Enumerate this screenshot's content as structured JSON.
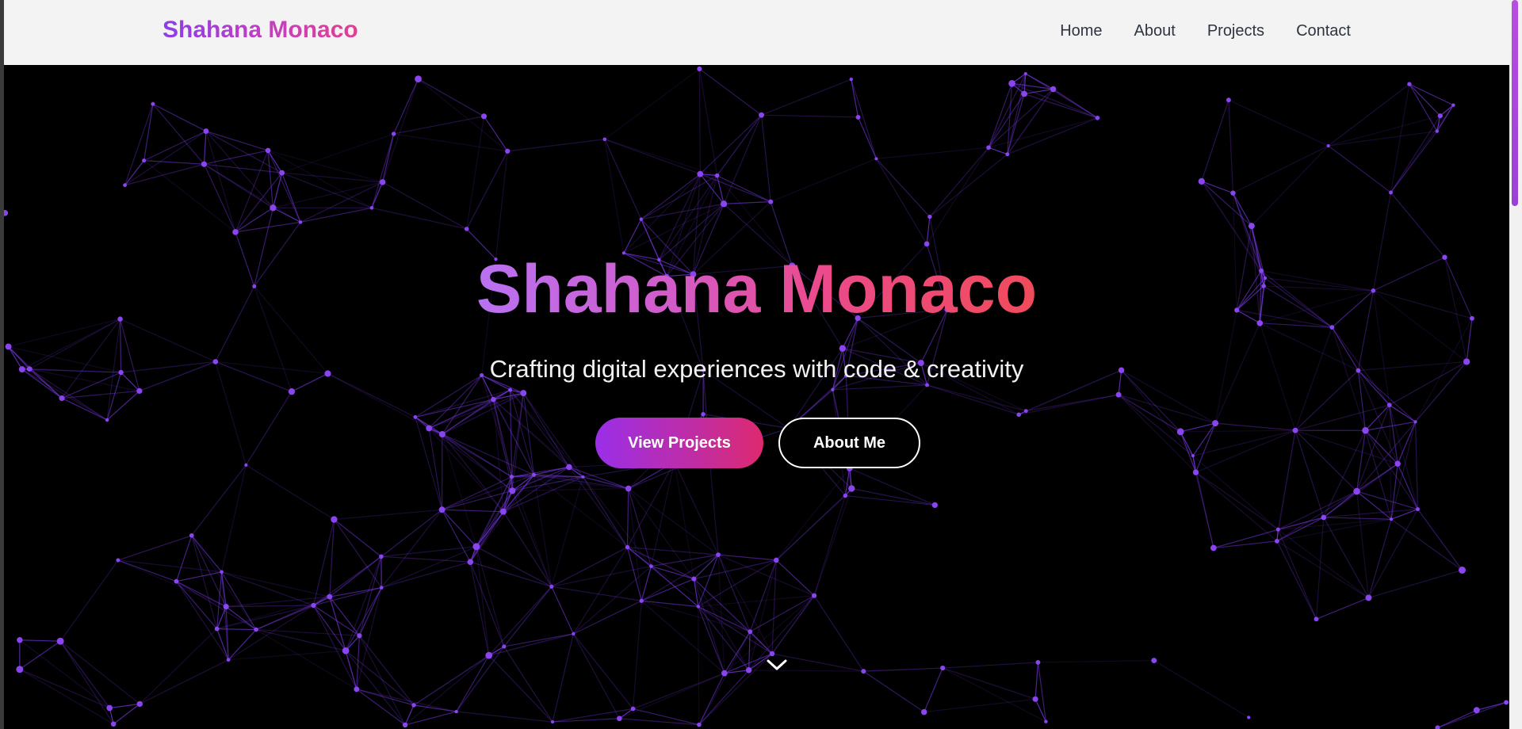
{
  "navbar": {
    "brand": "Shahana Monaco",
    "links": [
      "Home",
      "About",
      "Projects",
      "Contact"
    ]
  },
  "hero": {
    "title": "Shahana Monaco",
    "subtitle": "Crafting digital experiences with code & creativity",
    "primary_button": "View Projects",
    "secondary_button": "About Me",
    "scroll_icon": "chevron-down-icon"
  },
  "colors": {
    "accent_purple": "#9a2fe8",
    "accent_pink": "#dd2a6f",
    "network_line": "#7c3aed",
    "background": "#000000",
    "navbar_bg": "#f3f3f3"
  },
  "scrollbar": {
    "position_fraction": 0.0
  }
}
